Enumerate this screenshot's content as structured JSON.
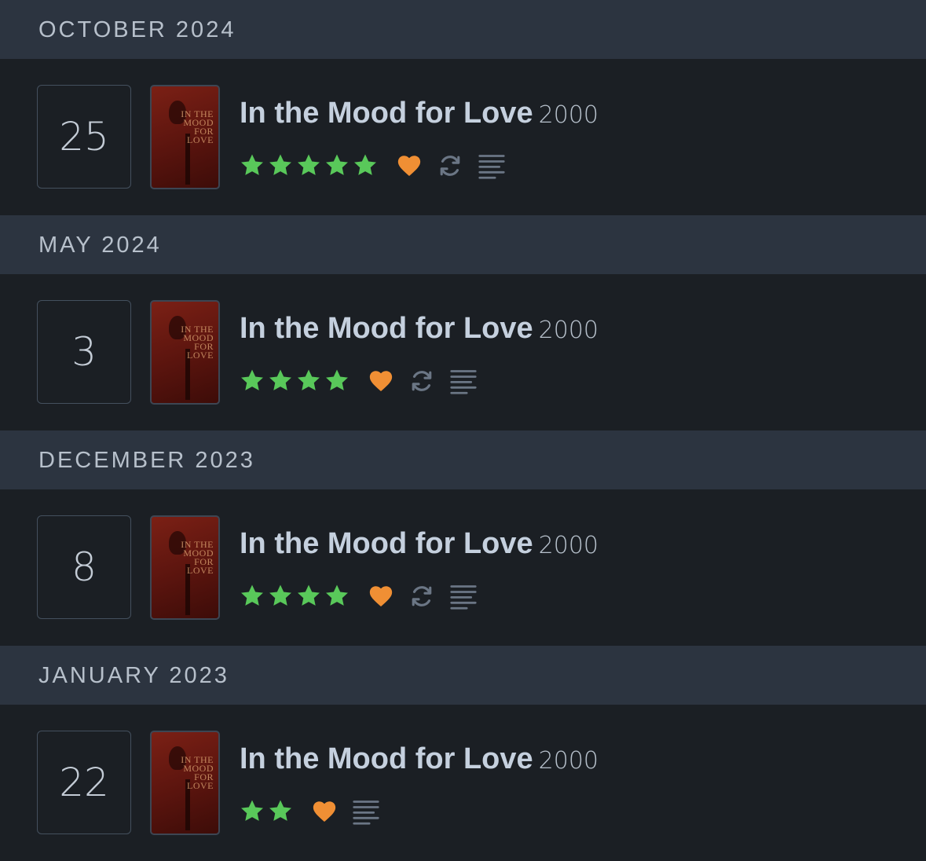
{
  "colors": {
    "star": "#59c85a",
    "heart": "#f08f34",
    "icon_grey": "#6b7685"
  },
  "entries": [
    {
      "month": "OCTOBER 2024",
      "day": "25",
      "title": "In the Mood for Love",
      "year": "2000",
      "rating": 5,
      "liked": true,
      "rewatch": true,
      "review": true
    },
    {
      "month": "MAY 2024",
      "day": "3",
      "title": "In the Mood for Love",
      "year": "2000",
      "rating": 4,
      "liked": true,
      "rewatch": true,
      "review": true
    },
    {
      "month": "DECEMBER 2023",
      "day": "8",
      "title": "In the Mood for Love",
      "year": "2000",
      "rating": 4,
      "liked": true,
      "rewatch": true,
      "review": true
    },
    {
      "month": "JANUARY 2023",
      "day": "22",
      "title": "In the Mood for Love",
      "year": "2000",
      "rating": 2,
      "liked": true,
      "rewatch": false,
      "review": true
    }
  ],
  "poster_text": [
    "IN THE",
    "MOOD",
    "FOR",
    "LOVE"
  ]
}
